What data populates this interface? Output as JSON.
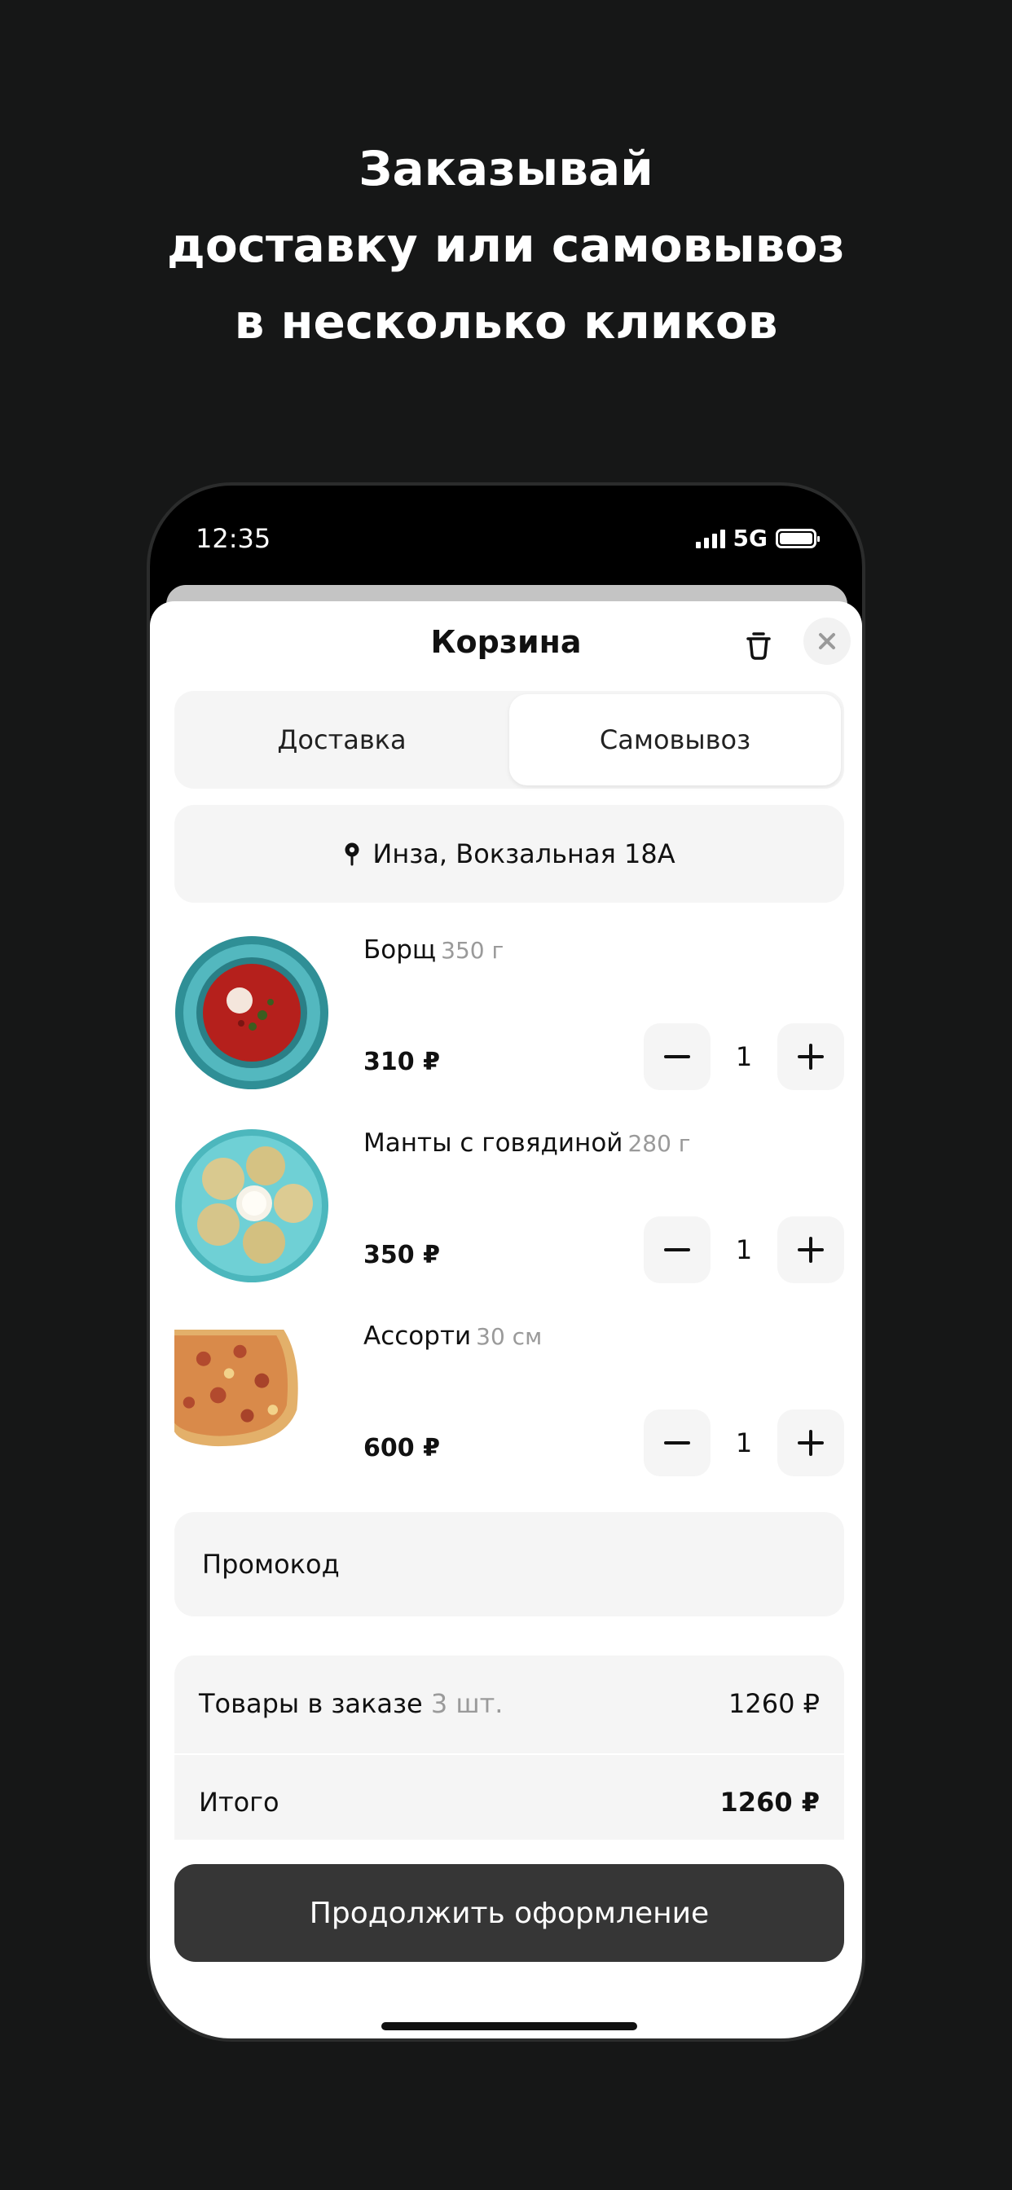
{
  "headline": {
    "line1": "Заказывай",
    "line2": "доставку или самовывоз",
    "line3": "в несколько кликов"
  },
  "status_bar": {
    "time": "12:35",
    "network": "5G"
  },
  "cart": {
    "title": "Корзина",
    "tabs": {
      "delivery": "Доставка",
      "pickup": "Самовывоз",
      "selected": "pickup"
    },
    "address": "Инза, Вокзальная 18А",
    "items": [
      {
        "name": "Борщ",
        "weight": "350 г",
        "price": "310 ₽",
        "qty": "1",
        "icon": "borscht-dish"
      },
      {
        "name": "Манты с говядиной",
        "weight": "280 г",
        "price": "350 ₽",
        "qty": "1",
        "icon": "manti-dish"
      },
      {
        "name": "Ассорти",
        "weight": "30 см",
        "price": "600 ₽",
        "qty": "1",
        "icon": "pizza"
      }
    ],
    "promo_placeholder": "Промокод",
    "summary": {
      "items_label": "Товары в заказе",
      "items_count": "3 шт.",
      "items_total": "1260 ₽",
      "total_label": "Итого",
      "total": "1260 ₽"
    },
    "continue_label": "Продолжить оформление"
  },
  "colors": {
    "background": "#161717",
    "sheet": "#ffffff",
    "field": "#f5f5f5",
    "button": "#363636",
    "muted_text": "#9a9a9a"
  }
}
